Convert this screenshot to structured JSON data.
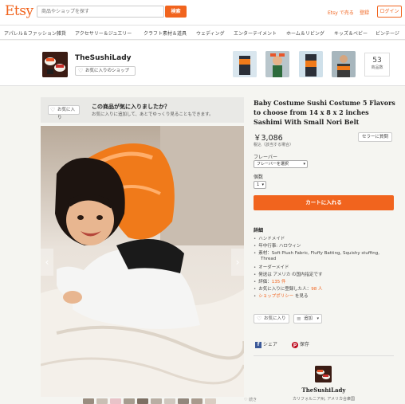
{
  "header": {
    "logo": "Etsy",
    "search_placeholder": "商品やショップを探す",
    "search_button": "検索",
    "sell_link": "Etsy で売る",
    "register_link": "登録",
    "login_button": "ログイン"
  },
  "categories": [
    "アパレル＆ファッション雑貨",
    "アクセサリー＆ジュエリー",
    "クラフト素材＆道具",
    "ウェディング",
    "エンターテイメント",
    "ホーム＆リビング",
    "キッズ＆ベビー",
    "ビンテージ"
  ],
  "shop": {
    "name": "TheSushiLady",
    "favorite_button": "お気に入りのショップ",
    "item_count": "53",
    "item_count_label": "商品数"
  },
  "fav_banner": {
    "button": "お気に入り",
    "title": "この商品が気に入りましたか？",
    "subtitle": "お気に入りに追加して、あとでゆっくり見ることもできます。"
  },
  "product": {
    "title": "Baby Costume Sushi Costume 5 Flavors to choose from 14 x 8 x 2 inches Sashimi With Small Nori Belt",
    "price": "￥3,086",
    "tax_note": "税込（該当する場合）",
    "sale_button": "セラーに質問",
    "flavor_label": "フレーバー",
    "flavor_select": "フレーバーを選択",
    "qty_label": "個数",
    "qty_value": "1",
    "cart_button": "カートに入れる"
  },
  "details": {
    "heading": "詳細",
    "items": [
      {
        "text": "ハンドメイド",
        "highlight": ""
      },
      {
        "text": "年中行事: ハロウィン",
        "highlight": ""
      },
      {
        "text": "素材：Soft Plush Fabric, Fluffy Batting, Squishy stuffing,",
        "highlight": ""
      },
      {
        "text": "Thread",
        "highlight": ""
      },
      {
        "text": "オーダーメイド",
        "highlight": ""
      },
      {
        "text": "発送は アメリカ の国内指定です",
        "highlight": ""
      },
      {
        "text": "評価：",
        "highlight": "135 件"
      },
      {
        "text": "お気に入りに登録した人：",
        "highlight": "98 人"
      },
      {
        "text": "",
        "highlight": "ショップポリシー",
        "suffix": " を見る"
      }
    ]
  },
  "actions": {
    "favorite": "お気に入り",
    "add": "追加",
    "share": "シェア",
    "save": "保存"
  },
  "seller": {
    "name": "TheSushiLady",
    "location": "カリフォルニア州, アメリカ合衆国"
  },
  "sidebar_note": "続き"
}
